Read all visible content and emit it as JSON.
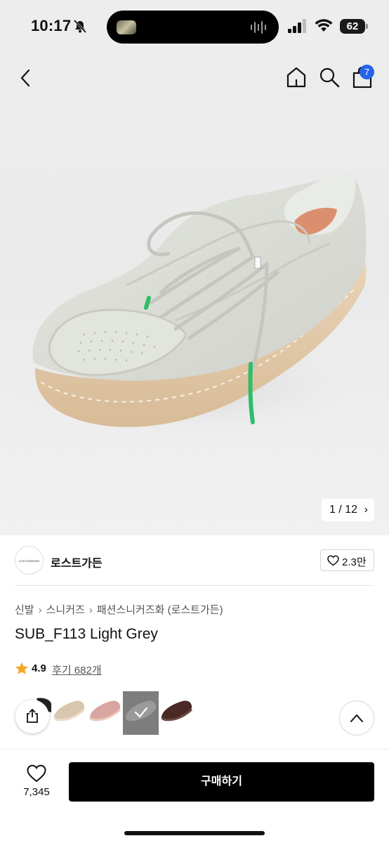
{
  "status_bar": {
    "time": "10:17",
    "battery": "62",
    "battery_fraction": 0.62
  },
  "nav": {
    "cart_badge": "7",
    "icons": [
      "chevron-left-icon",
      "home-icon",
      "search-icon",
      "shopping-bag-icon"
    ]
  },
  "gallery": {
    "pager": "1 / 12",
    "current": 1,
    "total": 12
  },
  "brand": {
    "logo_text": "LOSTGARDEN",
    "name": "로스트가든",
    "likes": "2.3만"
  },
  "breadcrumb": [
    "신발",
    "스니커즈",
    "패션스니커즈화 (로스트가든)"
  ],
  "product": {
    "title": "SUB_F113 Light Grey",
    "rating": "4.9",
    "reviews": "후기 682개"
  },
  "swatches": [
    {
      "color": "#d9c6ae",
      "selected": false
    },
    {
      "color": "#d8a5a0",
      "selected": false
    },
    {
      "color": "#9a9a98",
      "selected": true
    },
    {
      "color": "#4a2a24",
      "selected": false
    }
  ],
  "bottom_bar": {
    "wish_count": "7,345",
    "buy_label": "구매하기"
  },
  "colors": {
    "accent_badge": "#2563eb",
    "star": "#f4a522",
    "buy_button": "#000000"
  }
}
